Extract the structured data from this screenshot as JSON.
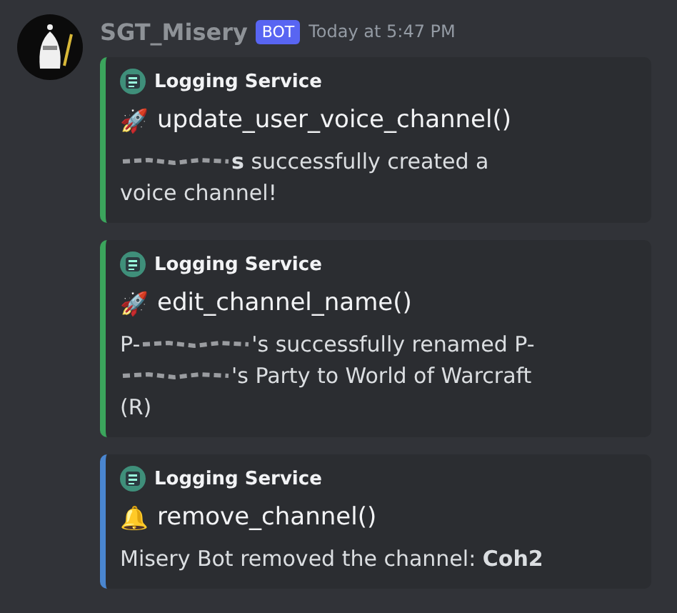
{
  "message": {
    "author": "SGT_Misery",
    "badge": "BOT",
    "timestamp": "Today at 5:47 PM"
  },
  "embeds": [
    {
      "color": "#3ba55c",
      "author": "Logging Service",
      "emoji": "🚀",
      "title": "update_user_voice_channel()",
      "description": [
        [
          {
            "kind": "redacted"
          },
          {
            "kind": "text",
            "text": "**s** successfully created a"
          }
        ],
        [
          {
            "kind": "text",
            "text": "voice channel!"
          }
        ]
      ]
    },
    {
      "color": "#3ba55c",
      "author": "Logging Service",
      "emoji": "🚀",
      "title": "edit_channel_name()",
      "description": [
        [
          {
            "kind": "text",
            "text": "P-"
          },
          {
            "kind": "redacted"
          },
          {
            "kind": "text",
            "text": "'s successfully renamed P-"
          }
        ],
        [
          {
            "kind": "redacted"
          },
          {
            "kind": "text",
            "text": "'s Party to World of Warcraft"
          }
        ],
        [
          {
            "kind": "text",
            "text": "(R)"
          }
        ]
      ]
    },
    {
      "color": "#4a86d0",
      "author": "Logging Service",
      "emoji": "🔔",
      "title": "remove_channel()",
      "description": [
        [
          {
            "kind": "text",
            "text": "Misery Bot removed the channel: **Coh2**"
          }
        ]
      ]
    }
  ]
}
